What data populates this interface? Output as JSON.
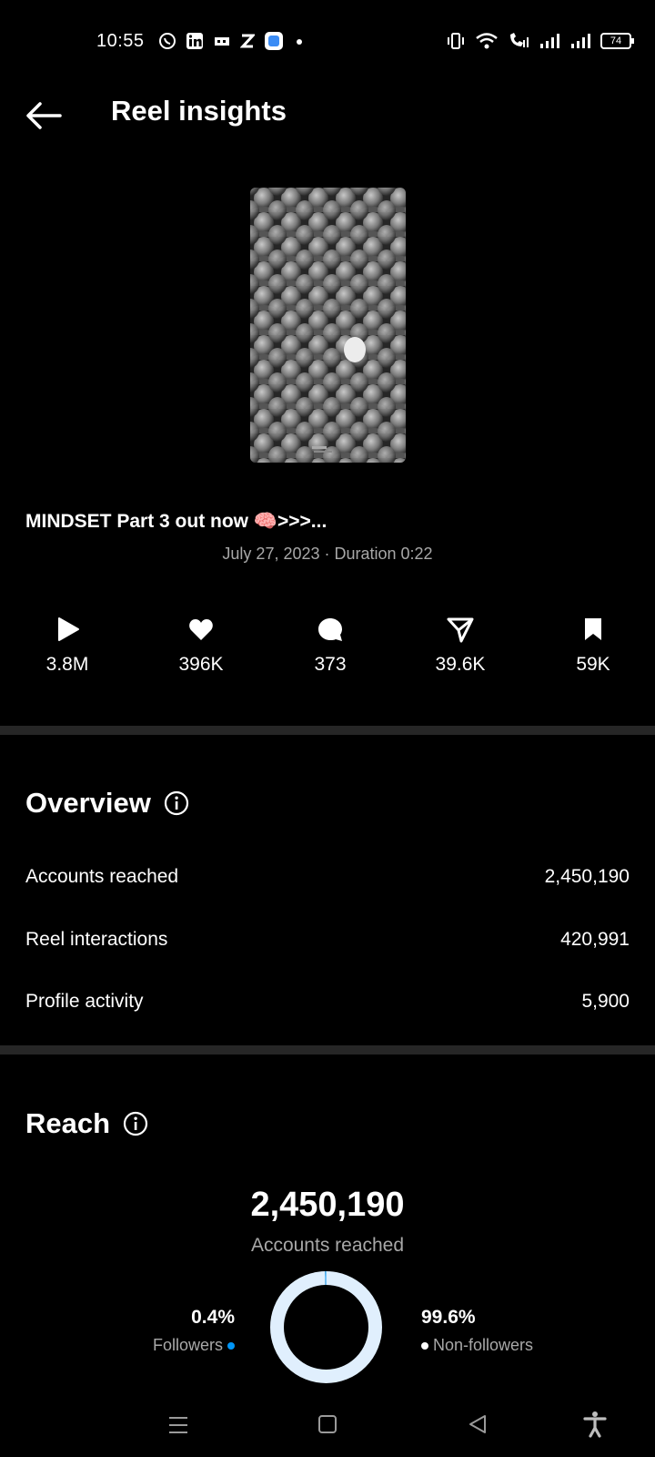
{
  "status_bar": {
    "time": "10:55",
    "left_icons": [
      "whatsapp-icon",
      "linkedin-icon",
      "sim-icon",
      "z-icon",
      "app-icon",
      "dot-icon"
    ],
    "right_icons": [
      "vibrate-icon",
      "wifi-icon",
      "volte-icon",
      "signal-icon",
      "signal-icon"
    ],
    "battery": "74"
  },
  "header": {
    "title": "Reel insights"
  },
  "reel": {
    "caption": "MINDSET Part 3 out now 🧠>>>...",
    "meta": "July 27, 2023 · Duration 0:22"
  },
  "stats": [
    {
      "icon": "play-icon",
      "value": "3.8M"
    },
    {
      "icon": "heart-icon",
      "value": "396K"
    },
    {
      "icon": "comment-icon",
      "value": "373"
    },
    {
      "icon": "share-icon",
      "value": "39.6K"
    },
    {
      "icon": "bookmark-icon",
      "value": "59K"
    }
  ],
  "overview": {
    "title": "Overview",
    "rows": [
      {
        "label": "Accounts reached",
        "value": "2,450,190"
      },
      {
        "label": "Reel interactions",
        "value": "420,991"
      },
      {
        "label": "Profile activity",
        "value": "5,900"
      }
    ]
  },
  "reach": {
    "title": "Reach",
    "total": "2,450,190",
    "subtitle": "Accounts reached",
    "followers": {
      "percent": "0.4%",
      "label": "Followers",
      "fraction": 0.004,
      "color": "#0095f6"
    },
    "non_followers": {
      "percent": "99.6%",
      "label": "Non-followers",
      "fraction": 0.996,
      "color": "#e0effd"
    }
  },
  "nav_bar": {
    "icons": [
      "menu-icon",
      "home-icon",
      "back-icon",
      "accessibility-icon"
    ]
  }
}
